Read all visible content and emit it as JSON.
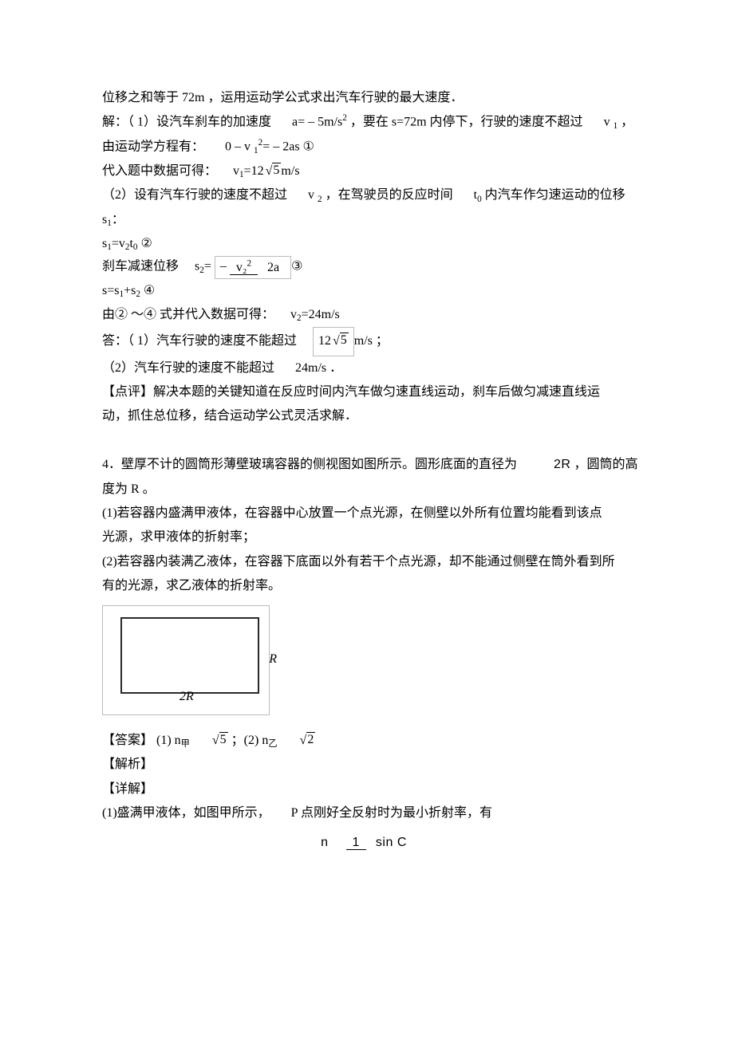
{
  "p1": "位移之和等于",
  "p1b": " 72m ，运用运动学公式求出汽车行驶的最大速度．",
  "p2": "解：（ 1）设汽车刹车的加速度",
  "p2b": "a= – 5m/s",
  "p2c": "2",
  "p2d": "，要在  s=72m 内停下，行驶的速度不超过",
  "p2e": "v",
  "p2f": "1",
  "p2g": "，",
  "p3": "由运动学方程有：",
  "p3b": "0 – v",
  "p3c": "1",
  "p3d": "2",
  "p3e": "= – 2as  ①",
  "p4": "代入题中数据可得：",
  "p4b": "v",
  "p4c": "1",
  "p4d": "=12",
  "p4e": "5",
  "p4f": "m/s",
  "p5": "（2）设有汽车行驶的速度不超过",
  "p5b": "v",
  "p5c": "2",
  "p5d": "，在驾驶员的反应时间",
  "p5e": "t",
  "p5f": "0",
  "p5g": "内汽车作匀速运动的位移",
  "p6": "s",
  "p6b": "1",
  "p6c": "：",
  "p7": "s",
  "p7b": "1",
  "p7c": "=v",
  "p7d": "2",
  "p7e": "t",
  "p7f": "0",
  "p7g": " ②",
  "p8": "刹车减速位移",
  "p8b": "s",
  "p8c": "2",
  "p8d": "=",
  "p8neg": "–",
  "p8num": "v₂",
  "p8numExp": "2",
  "p8den": "2a",
  "p8e": "③",
  "p9": "s=s",
  "p9b": "1",
  "p9c": "+s",
  "p9d": "2",
  "p9e": " ④",
  "p10": "由② ～④ 式并代入数据可得：",
  "p10b": "v",
  "p10c": "2",
  "p10d": "=24m/s",
  "p11": "答：（ 1）汽车行驶的速度不能超过",
  "p11num": "12",
  "p11rad": "5",
  "p11b": "m/s ；",
  "p12": "（2）汽车行驶的速度不能超过",
  "p12b": "24m/s ．",
  "p13": "【点评】解决本题的关键知道在反应时间内汽车做匀速直线运动，刹车后做匀减速直线运",
  "p14": "动，抓住总位移，结合运动学公式灵活求解．",
  "p15": "4．壁厚不计的圆筒形薄壁玻璃容器的侧视图如图所示。圆形底面的直径为",
  "p15b": "2R",
  "p15c": " ，圆筒的高",
  "p16": "度为 R 。",
  "p17": "(1)若容器内盛满甲液体，在容器中心放置一个点光源，在侧壁以外所有位置均能看到该点",
  "p18": "光源，求甲液体的折射率；",
  "p19": "(2)若容器内装满乙液体，在容器下底面以外有若干个点光源，却不能通过侧壁在筒外看到所",
  "p20": "有的光源，求乙液体的折射率。",
  "figR": "R",
  "fig2R": "2R",
  "ans1": "【答案】 (1) n",
  "ans1sub": "甲",
  "ans1rad": "5",
  "ans1sep": "；(2) n",
  "ans1sub2": "乙",
  "ans2rad": "2",
  "pA": "【解析】",
  "pB": "【详解】",
  "pC": "(1)盛满甲液体，如图甲所示，",
  "pCb": "P 点刚好全反射时为最小折射率，有",
  "fN": "n",
  "fNum": "1",
  "fDen": "sin C"
}
